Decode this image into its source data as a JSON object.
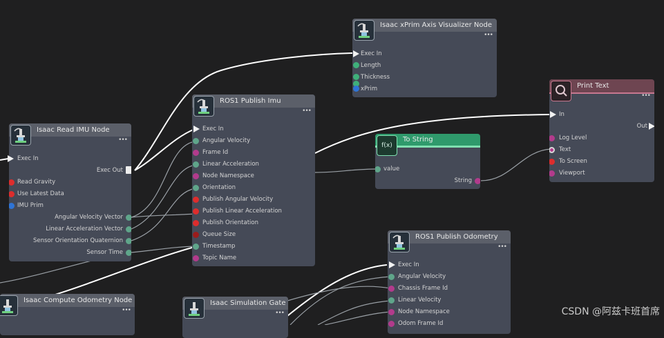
{
  "colors": {
    "canvas": "#1f1f20",
    "node_body": "#454a57",
    "node_header": "#5b5f69",
    "tostring_header": "#2f9a6c",
    "printtext_header": "#6e4551",
    "pin_red": "#dd2d2d",
    "pin_green": "#3fb07a",
    "pin_blue": "#2f74d6",
    "pin_magenta": "#b23b8c",
    "pin_darkred": "#9b1c1c",
    "pin_teal": "#5fa58a",
    "wire": "#ffffff"
  },
  "nodes": {
    "axis_vis": {
      "title": "Isaac xPrim Axis Visualizer Node",
      "inputs": [
        "Exec In",
        "Length",
        "Thickness",
        "xPrim"
      ]
    },
    "ros1_imu": {
      "title": "ROS1 Publish Imu",
      "inputs": [
        "Exec In",
        "Angular Velocity",
        "Frame Id",
        "Linear Acceleration",
        "Node Namespace",
        "Orientation",
        "Publish Angular Velocity",
        "Publish Linear Acceleration",
        "Publish Orientation",
        "Queue Size",
        "Timestamp",
        "Topic Name"
      ]
    },
    "read_imu": {
      "title": "Isaac Read IMU Node",
      "inputs": [
        "Exec In",
        "Read Gravity",
        "Use Latest Data",
        "IMU Prim"
      ],
      "outputs": [
        "Exec Out",
        "Angular Velocity Vector",
        "Linear Acceleration Vector",
        "Sensor Orientation Quaternion",
        "Sensor Time"
      ]
    },
    "to_string": {
      "title": "To String",
      "inputs": [
        "value"
      ],
      "outputs": [
        "String"
      ],
      "icon_text": "f(x)"
    },
    "print_text": {
      "title": "Print Text",
      "inputs": [
        "In",
        "Log Level",
        "Text",
        "To Screen",
        "Viewport"
      ],
      "outputs": [
        "Out"
      ]
    },
    "ros1_odom": {
      "title": "ROS1 Publish Odometry",
      "inputs": [
        "Exec In",
        "Angular Velocity",
        "Chassis Frame Id",
        "Linear Velocity",
        "Node Namespace",
        "Odom Frame Id"
      ]
    },
    "compute_odom": {
      "title": "Isaac Compute Odometry Node"
    },
    "sim_gate": {
      "title": "Isaac Simulation Gate"
    }
  },
  "watermark": "CSDN @阿兹卡班首席"
}
